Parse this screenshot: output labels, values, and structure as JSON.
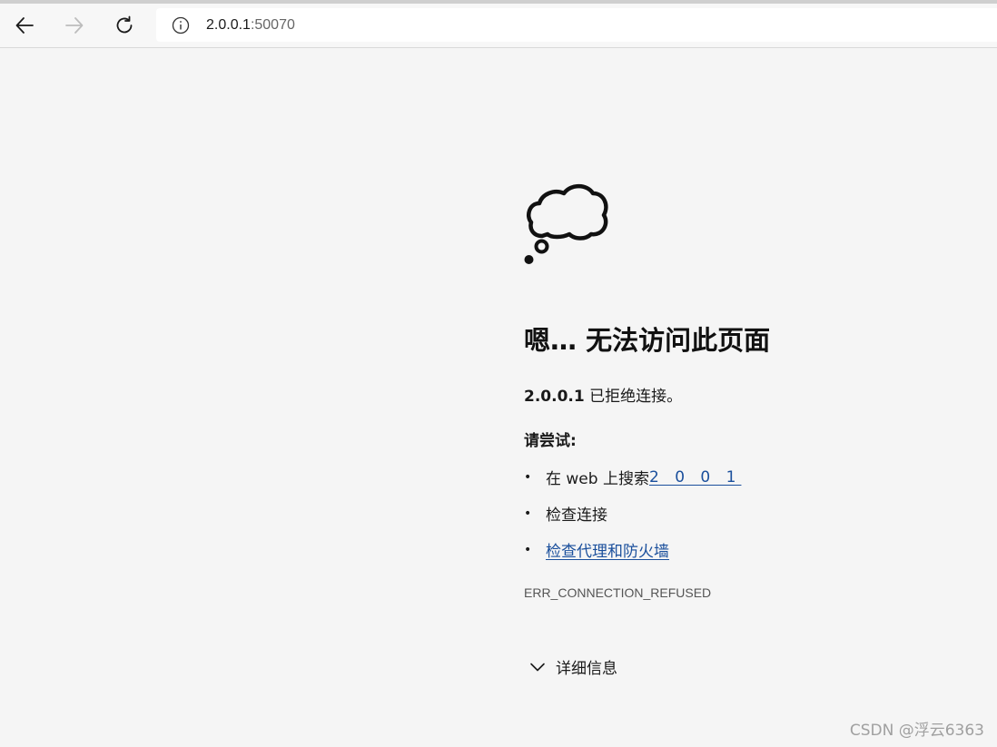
{
  "browser": {
    "url_host": "2.0.0.1",
    "url_port": ":50070",
    "back_icon": "arrow-left-icon",
    "forward_icon": "arrow-right-icon",
    "refresh_icon": "refresh-icon",
    "info_icon": "info-icon"
  },
  "error_page": {
    "icon": "thought-cloud-icon",
    "title": "嗯… 无法访问此页面",
    "host_bold": "2.0.0.1",
    "message": " 已拒绝连接。",
    "try_heading": "请尝试:",
    "suggestions": [
      {
        "prefix": "在 web 上搜索 ",
        "link": "2 0 0 1"
      },
      {
        "text": "检查连接"
      },
      {
        "link": "检查代理和防火墙"
      }
    ],
    "error_code": "ERR_CONNECTION_REFUSED",
    "details_label": "详细信息"
  },
  "watermark": "CSDN @浮云6363",
  "colors": {
    "link": "#1a4f9c",
    "background": "#f5f5f5"
  }
}
